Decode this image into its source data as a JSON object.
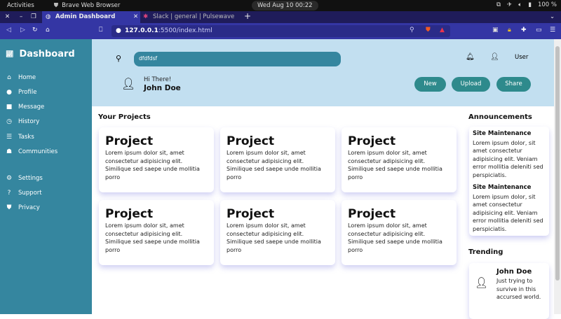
{
  "os": {
    "activities": "Activities",
    "app": "Brave Web Browser",
    "clock": "Wed Aug 10  00:22",
    "battery": "100 %"
  },
  "browser": {
    "tabs": [
      {
        "label": "Admin Dashboard"
      },
      {
        "label": "Slack | general | Pulsewave St"
      }
    ],
    "url_host": "127.0.0.1",
    "url_path": ":5500/index.html"
  },
  "sidebar": {
    "title": "Dashboard",
    "items": [
      {
        "label": "Home",
        "icon": "home-icon"
      },
      {
        "label": "Profile",
        "icon": "user-icon"
      },
      {
        "label": "Message",
        "icon": "message-icon"
      },
      {
        "label": "History",
        "icon": "clock-icon"
      },
      {
        "label": "Tasks",
        "icon": "tasks-icon"
      },
      {
        "label": "Communities",
        "icon": "communities-icon"
      },
      {
        "label": "Settings",
        "icon": "gear-icon"
      },
      {
        "label": "Support",
        "icon": "help-icon"
      },
      {
        "label": "Privacy",
        "icon": "shield-icon"
      }
    ]
  },
  "header": {
    "search_value": "dfdfdsf",
    "user_label": "User",
    "greeting": "Hi There!",
    "name": "John Doe",
    "buttons": {
      "new": "New",
      "upload": "Upload",
      "share": "Share"
    }
  },
  "projects": {
    "heading": "Your Projects",
    "items": [
      {
        "title": "Project",
        "desc": "Lorem ipsum dolor sit, amet consectetur adipisicing elit. Similique sed saepe unde mollitia porro"
      },
      {
        "title": "Project",
        "desc": "Lorem ipsum dolor sit, amet consectetur adipisicing elit. Similique sed saepe unde mollitia porro"
      },
      {
        "title": "Project",
        "desc": "Lorem ipsum dolor sit, amet consectetur adipisicing elit. Similique sed saepe unde mollitia porro"
      },
      {
        "title": "Project",
        "desc": "Lorem ipsum dolor sit, amet consectetur adipisicing elit. Similique sed saepe unde mollitia porro"
      },
      {
        "title": "Project",
        "desc": "Lorem ipsum dolor sit, amet consectetur adipisicing elit. Similique sed saepe unde mollitia porro"
      },
      {
        "title": "Project",
        "desc": "Lorem ipsum dolor sit, amet consectetur adipisicing elit. Similique sed saepe unde mollitia porro"
      }
    ]
  },
  "announcements": {
    "heading": "Announcements",
    "items": [
      {
        "title": "Site Maintenance",
        "body": "Lorem ipsum dolor, sit amet consectetur adipisicing elit. Veniam error mollitia deleniti sed perspiciatis."
      },
      {
        "title": "Site Maintenance",
        "body": "Lorem ipsum dolor, sit amet consectetur adipisicing elit. Veniam error mollitia deleniti sed perspiciatis."
      }
    ]
  },
  "trending": {
    "heading": "Trending",
    "name": "John Doe",
    "text": "Just trying to survive in this accursed world."
  }
}
